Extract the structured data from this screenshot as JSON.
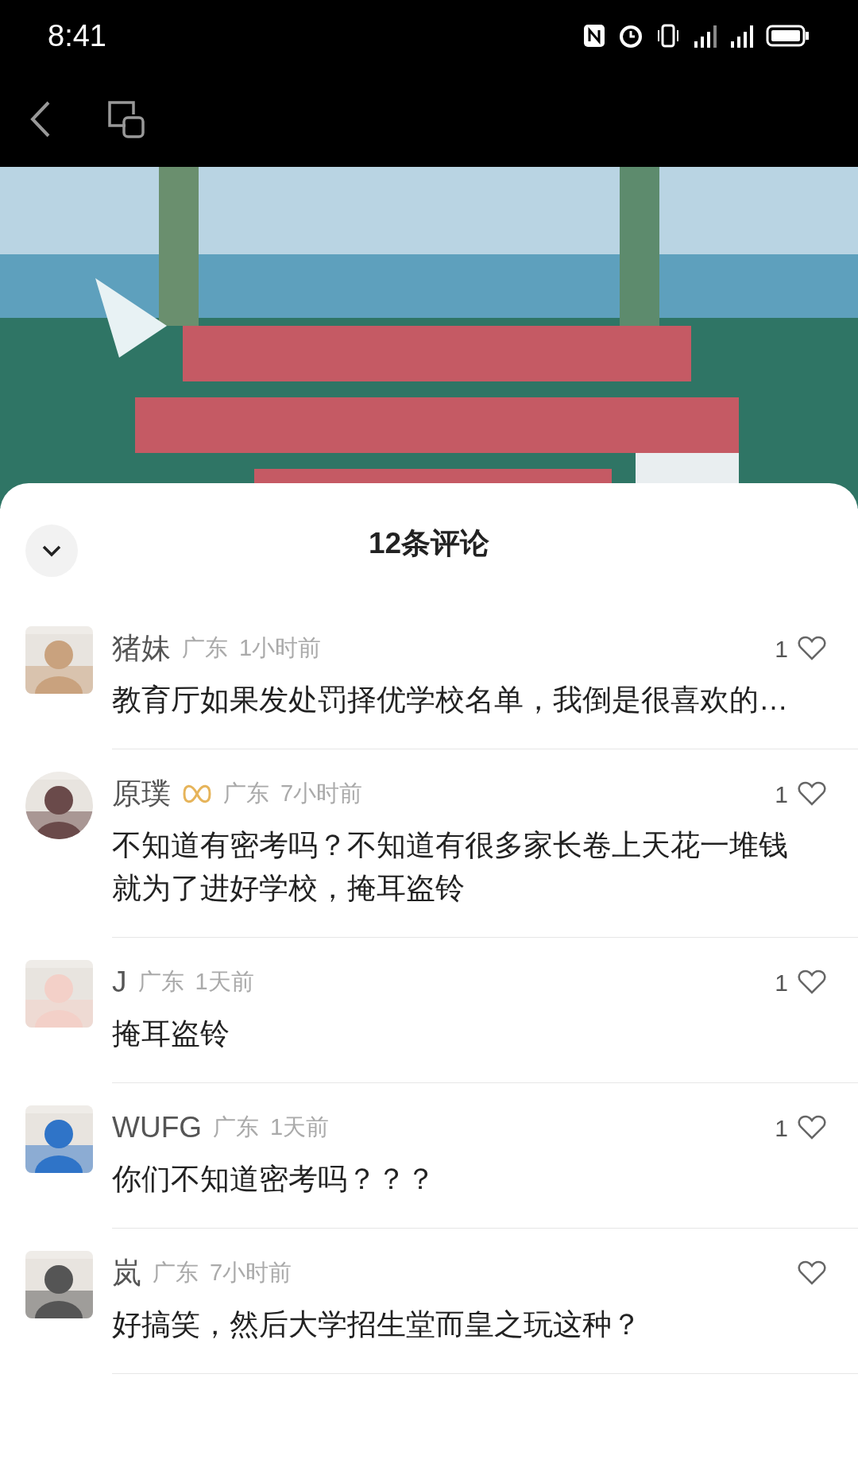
{
  "status_bar": {
    "time": "8:41"
  },
  "comments_sheet": {
    "title": "12条评论",
    "comments": [
      {
        "name": "猪妹",
        "badge": false,
        "location": "广东",
        "time": "1小时前",
        "likes": "1",
        "text": "教育厅如果发处罚择优学校名单，我倒是很喜欢的…",
        "avatar": {
          "round": false,
          "color": "#c9a27e"
        }
      },
      {
        "name": "原璞",
        "badge": true,
        "location": "广东",
        "time": "7小时前",
        "likes": "1",
        "text": "不知道有密考吗？不知道有很多家长卷上天花一堆钱就为了进好学校，掩耳盗铃",
        "avatar": {
          "round": true,
          "color": "#6a4a4a"
        }
      },
      {
        "name": "J",
        "badge": false,
        "location": "广东",
        "time": "1天前",
        "likes": "1",
        "text": "掩耳盗铃",
        "avatar": {
          "round": false,
          "color": "#f3d0c8"
        }
      },
      {
        "name": "WUFG",
        "badge": false,
        "location": "广东",
        "time": "1天前",
        "likes": "1",
        "text": "你们不知道密考吗？？？",
        "avatar": {
          "round": false,
          "color": "#2f74c8"
        }
      },
      {
        "name": "岚",
        "badge": false,
        "location": "广东",
        "time": "7小时前",
        "text": "好搞笑，然后大学招生堂而皇之玩这种？",
        "avatar": {
          "round": false,
          "color": "#555555"
        }
      }
    ]
  }
}
